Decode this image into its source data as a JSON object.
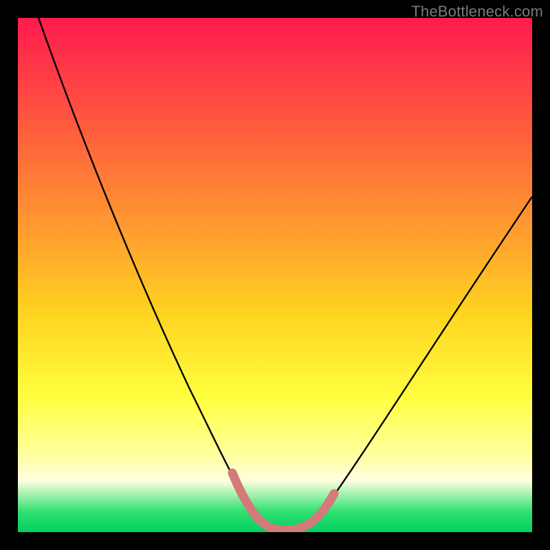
{
  "watermark": "TheBottleneck.com",
  "chart_data": {
    "type": "line",
    "title": "",
    "xlabel": "",
    "ylabel": "",
    "xlim": [
      0,
      100
    ],
    "ylim": [
      0,
      100
    ],
    "series": [
      {
        "name": "bottleneck-curve",
        "x": [
          4,
          10,
          16,
          22,
          28,
          33,
          37,
          40,
          43,
          45,
          47,
          49,
          50,
          52,
          54,
          56,
          58,
          62,
          68,
          76,
          86,
          96,
          100
        ],
        "values": [
          100,
          89,
          78,
          66,
          54,
          43,
          33,
          24,
          16,
          10,
          5,
          2,
          1,
          1,
          2,
          4,
          7,
          14,
          24,
          36,
          49,
          61,
          65
        ]
      },
      {
        "name": "highlight-band",
        "x": [
          40,
          42,
          44,
          46,
          48,
          49,
          50,
          51,
          52,
          54,
          56,
          58
        ],
        "values": [
          24,
          18,
          12,
          7,
          3,
          2,
          1,
          1,
          2,
          4,
          6,
          9
        ]
      }
    ],
    "colors": {
      "curve": "#000000",
      "highlight": "#d37a7a",
      "gradient_top": "#ff1a4d",
      "gradient_mid": "#ffff40",
      "gradient_bottom": "#00d060",
      "frame": "#000000"
    }
  }
}
